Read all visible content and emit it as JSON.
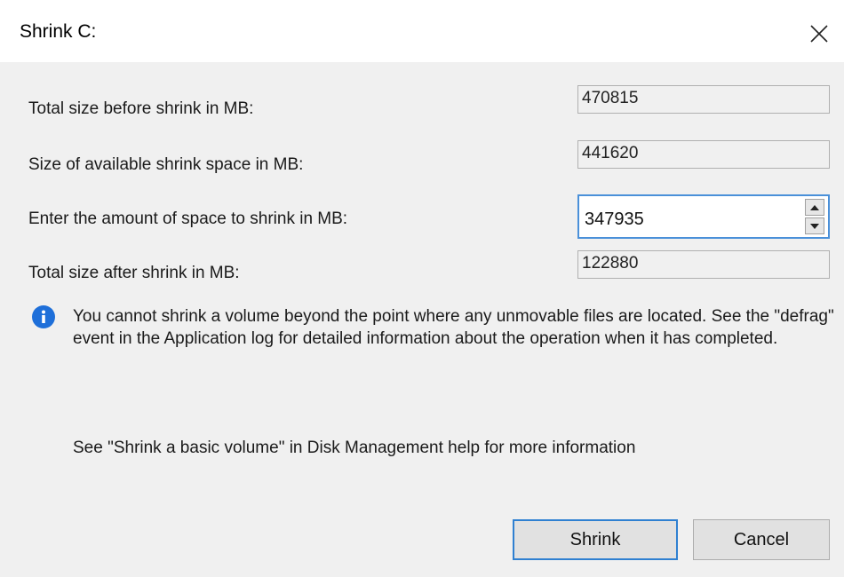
{
  "window": {
    "title": "Shrink C:"
  },
  "fields": {
    "total_before": {
      "label": "Total size before shrink in MB:",
      "value": "470815"
    },
    "available": {
      "label": "Size of available shrink space in MB:",
      "value": "441620"
    },
    "amount": {
      "label": "Enter the amount of space to shrink in MB:",
      "value": "347935"
    },
    "total_after": {
      "label": "Total size after shrink in MB:",
      "value": "122880"
    }
  },
  "info": {
    "icon": "info-icon",
    "message": "You cannot shrink a volume beyond the point where any unmovable files are located. See the \"defrag\" event in the Application log for detailed information about the operation when it has completed."
  },
  "help": {
    "text": "See \"Shrink a basic volume\" in Disk Management help for more information"
  },
  "buttons": {
    "shrink": "Shrink",
    "cancel": "Cancel"
  },
  "colors": {
    "accent": "#2f80d1",
    "info": "#1e6fd9",
    "body_bg": "#f0f0f0"
  }
}
